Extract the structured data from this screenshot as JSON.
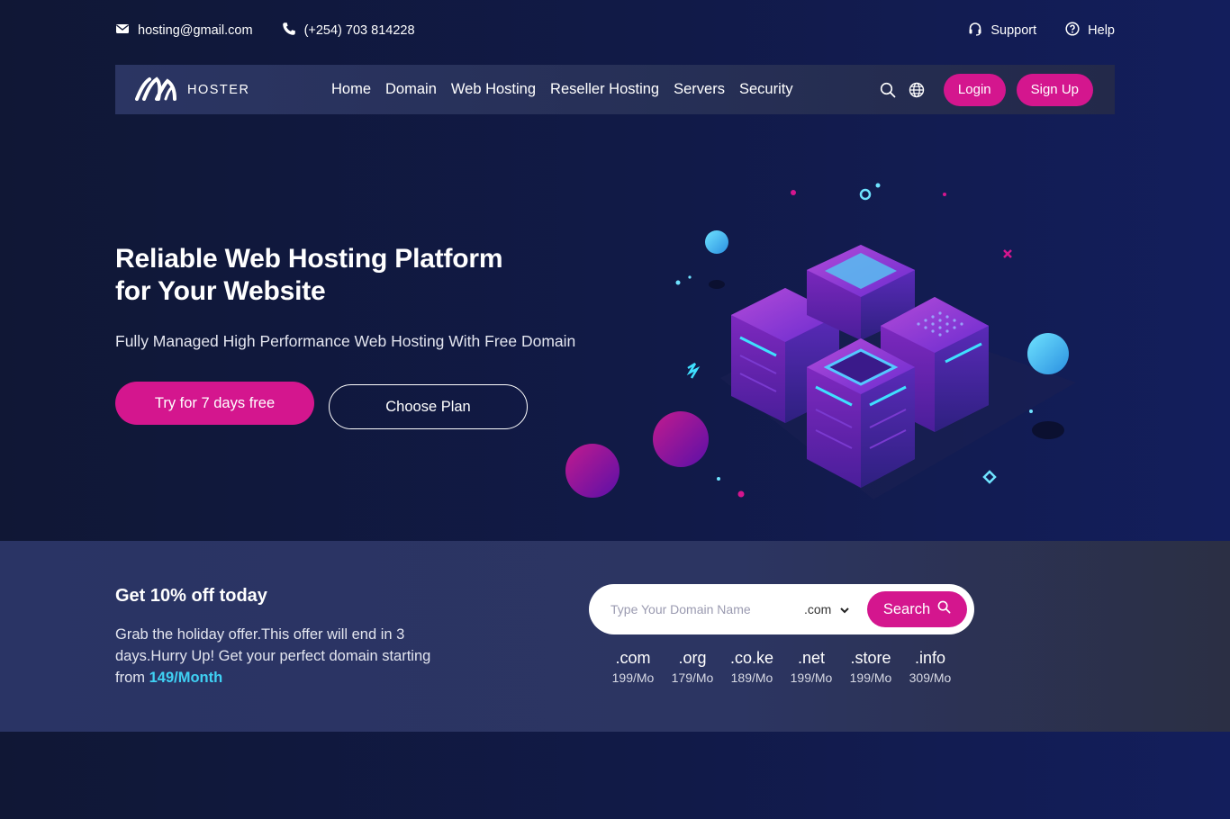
{
  "topbar": {
    "email": "hosting@gmail.com",
    "phone": "(+254) 703 814228",
    "support_label": "Support",
    "help_label": "Help"
  },
  "nav": {
    "logo_text": "HOSTER",
    "links": [
      "Home",
      "Domain",
      "Web Hosting",
      "Reseller Hosting",
      "Servers",
      "Security"
    ],
    "login_label": "Login",
    "signup_label": "Sign Up"
  },
  "hero": {
    "title_line1": "Reliable Web Hosting Platform",
    "title_line2": "for Your Website",
    "subtitle": "Fully Managed High Performance Web Hosting With Free Domain",
    "primary_cta": "Try for 7 days free",
    "secondary_cta": "Choose Plan"
  },
  "offer": {
    "title": "Get 10% off today",
    "text_before": "Grab the holiday offer.This offer will end in 3 days.Hurry Up! Get your perfect domain starting from ",
    "highlight": "149/Month"
  },
  "search": {
    "placeholder": "Type Your Domain Name",
    "selected_tld": ".com",
    "button_label": "Search"
  },
  "tld_prices": [
    {
      "ext": ".com",
      "price": "199/Mo"
    },
    {
      "ext": ".org",
      "price": "179/Mo"
    },
    {
      "ext": ".co.ke",
      "price": "189/Mo"
    },
    {
      "ext": ".net",
      "price": "199/Mo"
    },
    {
      "ext": ".store",
      "price": "199/Mo"
    },
    {
      "ext": ".info",
      "price": "309/Mo"
    }
  ],
  "colors": {
    "accent": "#d4168e",
    "highlight": "#3fd1f4",
    "background": "#111a48"
  }
}
